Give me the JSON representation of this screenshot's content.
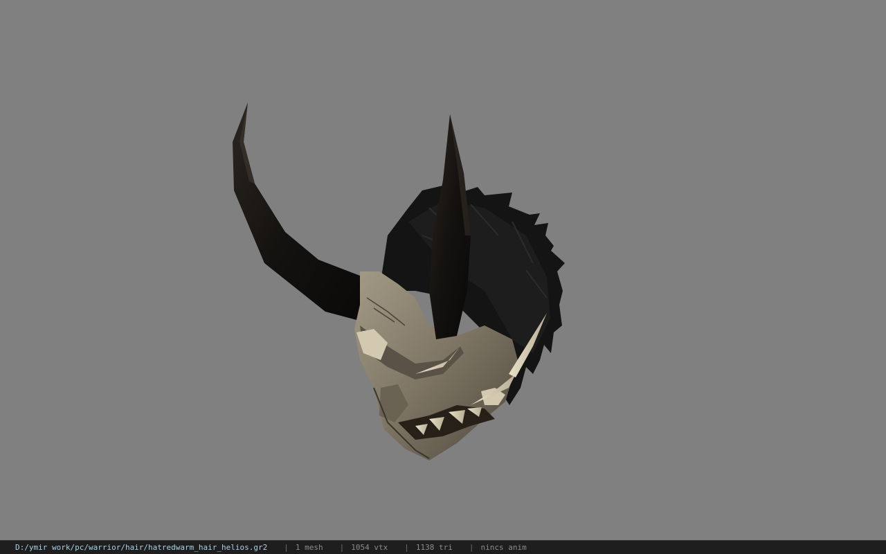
{
  "viewport": {
    "background_color": "#808080",
    "model_icon": "oni-mask-helmet-model"
  },
  "statusbar": {
    "path": "D:/ymir work/pc/warrior/hair/hatredwarm_hair_helios.gr2",
    "separator": "|",
    "mesh": "1 mesh",
    "vtx": "1054 vtx",
    "tri": "1138 tri",
    "anim": "nincs anim",
    "path_color": "#a8d2e6",
    "text_color": "#8c8c8c"
  }
}
